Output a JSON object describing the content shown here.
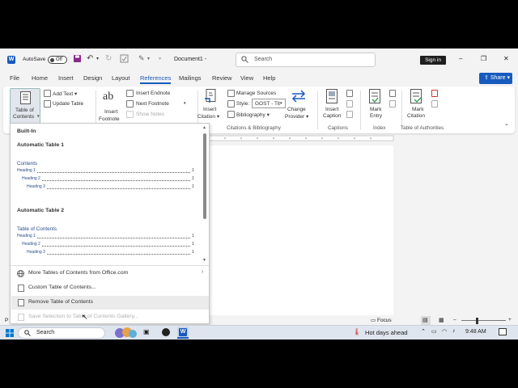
{
  "title_bar": {
    "autosave_label": "AutoSave",
    "autosave_state": "Off",
    "doc_title": "Document1 -",
    "search_placeholder": "Search",
    "signin_label": "Sign in",
    "minimize_glyph": "–",
    "restore_glyph": "❐",
    "close_glyph": "✕"
  },
  "menu": {
    "tabs": [
      "File",
      "Home",
      "Insert",
      "Design",
      "Layout",
      "References",
      "Mailings",
      "Review",
      "View",
      "Help"
    ],
    "active": "References",
    "share_label": "Share"
  },
  "ribbon": {
    "toc": {
      "label1": "Table of",
      "label2": "Contents",
      "add_text": "Add Text",
      "update_table": "Update Table"
    },
    "footnotes": {
      "glyph": "ab",
      "label1": "Insert",
      "label2": "Footnote",
      "insert_endnote": "Insert Endnote",
      "next_footnote": "Next Footnote",
      "show_notes": "Show Notes"
    },
    "research": {
      "label1": "Insert",
      "label2": "Citation"
    },
    "citations": {
      "manage_sources": "Manage Sources",
      "style_label": "Style:",
      "style_value": "GOST - Tit",
      "bibliography": "Bibliography",
      "change_label1": "Change",
      "change_label2": "Provider",
      "group_label": "Citations & Bibliography"
    },
    "captions": {
      "label1": "Insert",
      "label2": "Caption",
      "group_label": "Captions"
    },
    "index": {
      "label1": "Mark",
      "label2": "Entry",
      "group_label": "Index"
    },
    "authorities": {
      "label1": "Mark",
      "label2": "Citation",
      "group_label": "Table of Authorities"
    }
  },
  "gallery": {
    "builtin_header": "Built-In",
    "auto1": {
      "name": "Automatic Table 1",
      "title": "Contents",
      "entries": [
        {
          "text": "Heading 1",
          "page": "1"
        },
        {
          "text": "Heading 2",
          "page": "1"
        },
        {
          "text": "Heading 3",
          "page": "1"
        }
      ]
    },
    "auto2": {
      "name": "Automatic Table 2",
      "title": "Table of Contents",
      "entries": [
        {
          "text": "Heading 1",
          "page": "1"
        },
        {
          "text": "Heading 2",
          "page": "1"
        },
        {
          "text": "Heading 3",
          "page": "1"
        }
      ]
    },
    "menu_items": [
      {
        "label": "More Tables of Contents from Office.com",
        "has_arrow": true,
        "disabled": false
      },
      {
        "label": "Custom Table of Contents...",
        "has_arrow": false,
        "disabled": false
      },
      {
        "label": "Remove Table of Contents",
        "has_arrow": false,
        "disabled": false
      },
      {
        "label": "Save Selection to Table of Contents Gallery...",
        "has_arrow": false,
        "disabled": true
      }
    ]
  },
  "status_bar": {
    "page_label": "P",
    "focus_label": "Focus"
  },
  "taskbar": {
    "search_label": "Search",
    "weather_text": "Hot days ahead",
    "time": "9:48 AM"
  },
  "colors": {
    "accent": "#185abd",
    "ribbon_bg": "#ffffff",
    "chrome_bg": "#f3f3f3",
    "taskbar_bg": "#dfe5ee"
  }
}
